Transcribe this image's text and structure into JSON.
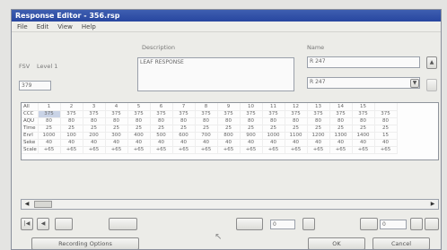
{
  "window": {
    "title": "Response Editor - 356.rsp"
  },
  "menu": [
    "File",
    "Edit",
    "View",
    "Help"
  ],
  "form": {
    "description_label": "Description",
    "description_value": "LEAF RESPONSE",
    "name_label": "Name",
    "name_value": "R 247",
    "name_select": "R 247",
    "row_prefix": "FSV",
    "level_label": "Level 1",
    "left_value": "379"
  },
  "grid": {
    "columns": [
      "All",
      "1",
      "2",
      "3",
      "4",
      "5",
      "6",
      "7",
      "8",
      "9",
      "10",
      "11",
      "12",
      "13",
      "14",
      "15",
      ""
    ],
    "rows": [
      {
        "label": "CCC",
        "cells": [
          "375",
          "375",
          "375",
          "375",
          "375",
          "375",
          "375",
          "375",
          "375",
          "375",
          "375",
          "375",
          "375",
          "375",
          "375",
          "375"
        ]
      },
      {
        "label": "AQU",
        "cells": [
          "80",
          "80",
          "80",
          "80",
          "80",
          "80",
          "80",
          "80",
          "80",
          "80",
          "80",
          "80",
          "80",
          "80",
          "80",
          "80"
        ]
      },
      {
        "label": "Time",
        "cells": [
          "25",
          "25",
          "25",
          "25",
          "25",
          "25",
          "25",
          "25",
          "25",
          "25",
          "25",
          "25",
          "25",
          "25",
          "25",
          "25"
        ]
      },
      {
        "label": "Enrl",
        "cells": [
          "1000",
          "100",
          "200",
          "300",
          "400",
          "500",
          "600",
          "700",
          "800",
          "900",
          "1000",
          "1100",
          "1200",
          "1300",
          "1400",
          "15"
        ]
      },
      {
        "label": "Seke",
        "cells": [
          "40",
          "40",
          "40",
          "40",
          "40",
          "40",
          "40",
          "40",
          "40",
          "40",
          "40",
          "40",
          "40",
          "40",
          "40",
          "40"
        ]
      },
      {
        "label": "Scale",
        "cells": [
          "+65",
          "+65",
          "+65",
          "+65",
          "+65",
          "+65",
          "+65",
          "+65",
          "+65",
          "+65",
          "+65",
          "+65",
          "+65",
          "+65",
          "+65",
          "+65"
        ]
      }
    ]
  },
  "buttons": {
    "recording_options": "Recording Options",
    "ok": "OK",
    "cancel": "Cancel"
  },
  "counters": {
    "left": "0",
    "right": "0"
  }
}
